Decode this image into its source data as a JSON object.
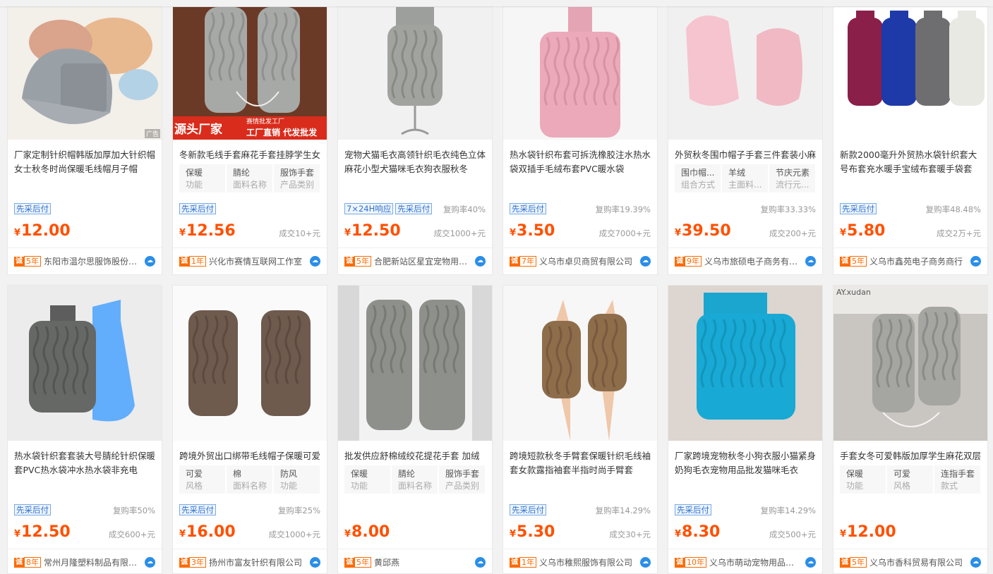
{
  "colors": {
    "price": "#ff5000",
    "tag": "#3072c8",
    "badge": "#ff6a00",
    "wangwang": "#2a8ee8"
  },
  "labels": {
    "currency": "¥",
    "cheng_badge": "诚",
    "ad": "广告"
  },
  "products": [
    {
      "title": "厂家定制针织帽韩版加厚加大针织帽女士秋冬时尚保暖毛线帽月子帽",
      "attrs": [],
      "tags": [
        "先采后付"
      ],
      "rebuy": "",
      "price": "12.00",
      "sold": "",
      "years": "5年",
      "shop": "东阳市温尔思服饰股份有限公司",
      "image": "beanie-icon",
      "ad": true
    },
    {
      "title": "冬新款毛线手套麻花手套挂脖学生女",
      "attrs": [
        {
          "v": "保暖",
          "k": "功能"
        },
        {
          "v": "腈纶",
          "k": "面料名称"
        },
        {
          "v": "服饰手套",
          "k": "产品类别"
        }
      ],
      "tags": [
        "先采后付"
      ],
      "rebuy": "",
      "price": "12.56",
      "sold": "成交10+元",
      "years": "1年",
      "shop": "兴化市赛情互联网工作室",
      "image": "mitten-icon",
      "banner": {
        "a": "源头厂家",
        "b": "赛情批发工厂",
        "c": "工厂直销  代发批发"
      }
    },
    {
      "title": "宠物犬猫毛衣高领针织毛衣纯色立体麻花小型犬猫咪毛衣狗衣服秋冬",
      "attrs": [],
      "tags": [
        "7×24H响应",
        "先采后付"
      ],
      "rebuy": "复购率40%",
      "price": "12.50",
      "sold": "成交1000+元",
      "years": "5年",
      "shop": "合肥新站区星宜宠物用品店",
      "image": "pet-sweater-icon"
    },
    {
      "title": "热水袋针织布套可拆洗橡胶注水热水袋双插手毛绒布套PVC暖水袋",
      "attrs": [],
      "tags": [
        "先采后付"
      ],
      "rebuy": "复购率19.39%",
      "price": "3.50",
      "sold": "成交7000+元",
      "years": "7年",
      "shop": "义乌市卓贝商贸有限公司",
      "image": "hot-water-bag-icon"
    },
    {
      "title": "外贸秋冬围巾帽子手套三件套装小麻",
      "attrs": [
        {
          "v": "围巾帽...",
          "k": "组合方式"
        },
        {
          "v": "羊绒",
          "k": "主面料..."
        },
        {
          "v": "节庆元素",
          "k": "流行元..."
        }
      ],
      "tags": [],
      "rebuy": "复购率33.33%",
      "price": "39.50",
      "sold": "成交200+元",
      "years": "9年",
      "shop": "义乌市旅硕电子商务有限公司",
      "image": "pink-set-icon"
    },
    {
      "title": "新款2000毫升外贸热水袋针织套大号布套充水暖手宝绒布套暖手袋套",
      "attrs": [],
      "tags": [
        "先采后付"
      ],
      "rebuy": "复购率48.48%",
      "price": "5.80",
      "sold": "成交2万+元",
      "years": "5年",
      "shop": "义乌市鑫苑电子商务商行",
      "image": "colored-bags-icon"
    },
    {
      "title": "热水袋针织套套装大号腈纶针织保暖套PVC热水袋冲水热水袋非充电",
      "attrs": [],
      "tags": [
        "先采后付"
      ],
      "rebuy": "复购率50%",
      "price": "12.50",
      "sold": "成交600+元",
      "years": "8年",
      "shop": "常州月隆塑料制品有限公司",
      "image": "gray-bag-icon"
    },
    {
      "title": "跨境外贸出口绑带毛线帽子保暖可爱",
      "attrs": [
        {
          "v": "可爱",
          "k": "风格"
        },
        {
          "v": "棉",
          "k": "面料名称"
        },
        {
          "v": "防风",
          "k": "功能"
        }
      ],
      "tags": [
        "先采后付"
      ],
      "rebuy": "复购率25%",
      "price": "16.00",
      "sold": "成交1000+元",
      "years": "3年",
      "shop": "扬州市富友针织有限公司",
      "image": "brown-mittens-icon"
    },
    {
      "title": "批发供应舒棉绒绞花提花手套 加绒加",
      "attrs": [
        {
          "v": "保暖",
          "k": "功能"
        },
        {
          "v": "腈纶",
          "k": "面料名称"
        },
        {
          "v": "服饰手套",
          "k": "产品类别"
        }
      ],
      "tags": [],
      "rebuy": "",
      "price": "8.00",
      "sold": "",
      "years": "5年",
      "shop": "黄邱燕",
      "image": "gray-mittens-icon"
    },
    {
      "title": "跨境短款秋冬手臂套保暖针织毛线袖套女款露指袖套半指时尚手臂套",
      "attrs": [],
      "tags": [
        "先采后付"
      ],
      "rebuy": "复购率14.29%",
      "price": "5.30",
      "sold": "成交30+元",
      "years": "1年",
      "shop": "义乌市稚熙服饰有限公司",
      "image": "arm-warmer-icon"
    },
    {
      "title": "厂家跨境宠物秋冬小狗衣服小猫紧身奶狗毛衣宠物用品批发猫咪毛衣",
      "attrs": [],
      "tags": [
        "先采后付"
      ],
      "rebuy": "复购率14.29%",
      "price": "8.30",
      "sold": "成交500+元",
      "years": "10年",
      "shop": "义乌市萌动宠物用品有限公司",
      "image": "blue-sweater-icon"
    },
    {
      "title": "手套女冬可爱韩版加厚学生麻花双层",
      "attrs": [
        {
          "v": "保暖",
          "k": "功能"
        },
        {
          "v": "可爱",
          "k": "风格"
        },
        {
          "v": "连指手套",
          "k": "款式"
        }
      ],
      "tags": [],
      "rebuy": "",
      "price": "12.00",
      "sold": "",
      "years": "5年",
      "shop": "义乌市香科贸易有限公司",
      "image": "gray-mittens-string-icon",
      "watermark": "AY.xudan"
    }
  ]
}
